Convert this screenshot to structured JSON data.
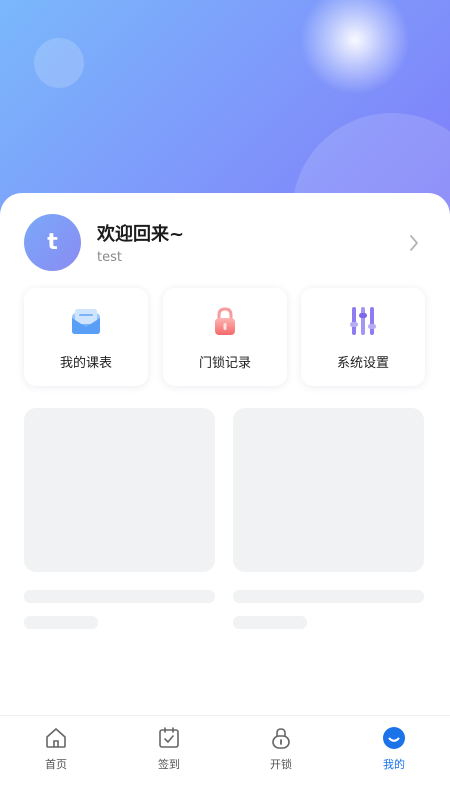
{
  "profile": {
    "avatar_letter": "t",
    "greeting": "欢迎回来~",
    "username": "test"
  },
  "quick_actions": [
    {
      "label": "我的课表",
      "icon": "envelope-icon"
    },
    {
      "label": "门锁记录",
      "icon": "padlock-icon"
    },
    {
      "label": "系统设置",
      "icon": "sliders-icon"
    }
  ],
  "tabbar": {
    "items": [
      {
        "label": "首页",
        "icon": "home-icon",
        "active": false
      },
      {
        "label": "签到",
        "icon": "calendar-check-icon",
        "active": false
      },
      {
        "label": "开锁",
        "icon": "lock-icon",
        "active": false
      },
      {
        "label": "我的",
        "icon": "smile-icon",
        "active": true
      }
    ]
  },
  "colors": {
    "accent": "#1a73e8",
    "hero_start": "#7ab8fb",
    "hero_end": "#7f7cf8",
    "skeleton": "#f1f2f4"
  }
}
